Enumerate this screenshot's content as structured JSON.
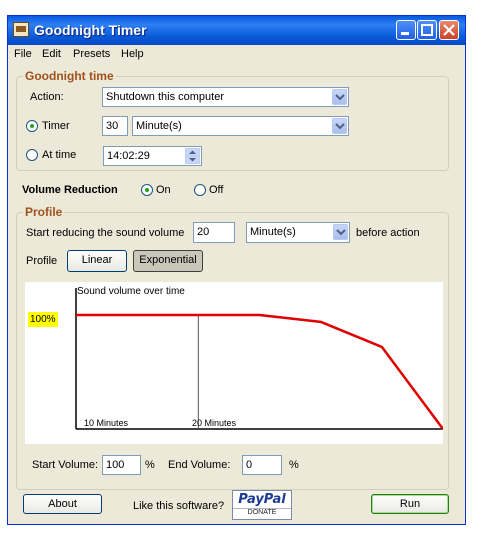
{
  "window": {
    "title": "Goodnight Timer",
    "controls": [
      "minimize",
      "maximize",
      "close"
    ]
  },
  "menu": [
    "File",
    "Edit",
    "Presets",
    "Help"
  ],
  "goodnight_time": {
    "legend": "Goodnight time",
    "action_label": "Action:",
    "action_value": "Shutdown this computer",
    "timer_label": "Timer",
    "timer_value": "30",
    "timer_unit": "Minute(s)",
    "at_time_label": "At time",
    "at_time_value": "14:02:29",
    "selected_mode": "Timer"
  },
  "volume_reduction": {
    "label": "Volume Reduction",
    "on_label": "On",
    "off_label": "Off",
    "selected": "On"
  },
  "profile": {
    "legend": "Profile",
    "start_label": "Start reducing the sound volume",
    "start_value": "20",
    "start_unit": "Minute(s)",
    "before_label": "before action",
    "profile_label": "Profile",
    "linear_label": "Linear",
    "exponential_label": "Exponential",
    "selected_profile": "Exponential"
  },
  "chart_data": {
    "type": "line",
    "title": "Sound volume over time",
    "y_marker_label": "100%",
    "x_tick_labels": [
      "10 Minutes",
      "20 Minutes"
    ],
    "x": [
      0,
      10,
      15,
      20,
      25,
      30
    ],
    "values": [
      100,
      100,
      100,
      94,
      72,
      0
    ],
    "series": [
      {
        "values": [
          100,
          100,
          100,
          94,
          72,
          0
        ],
        "color": "#e00000"
      }
    ],
    "xlim": [
      0,
      30
    ],
    "ylim": [
      0,
      100
    ],
    "grid": false
  },
  "volume_fields": {
    "start_label": "Start Volume:",
    "start_value": "100",
    "start_unit": "%",
    "end_label": "End Volume:",
    "end_value": "0",
    "end_unit": "%"
  },
  "footer": {
    "about_label": "About",
    "like_label": "Like this software?",
    "paypal_brand": "PayPal",
    "paypal_donate": "DONATE",
    "run_label": "Run"
  },
  "colors": {
    "title_bar": "#0a5ae0",
    "window_bg": "#ece9d8",
    "legend_text": "#a0521c",
    "curve": "#e00000",
    "marker_highlight": "#ffff00"
  }
}
